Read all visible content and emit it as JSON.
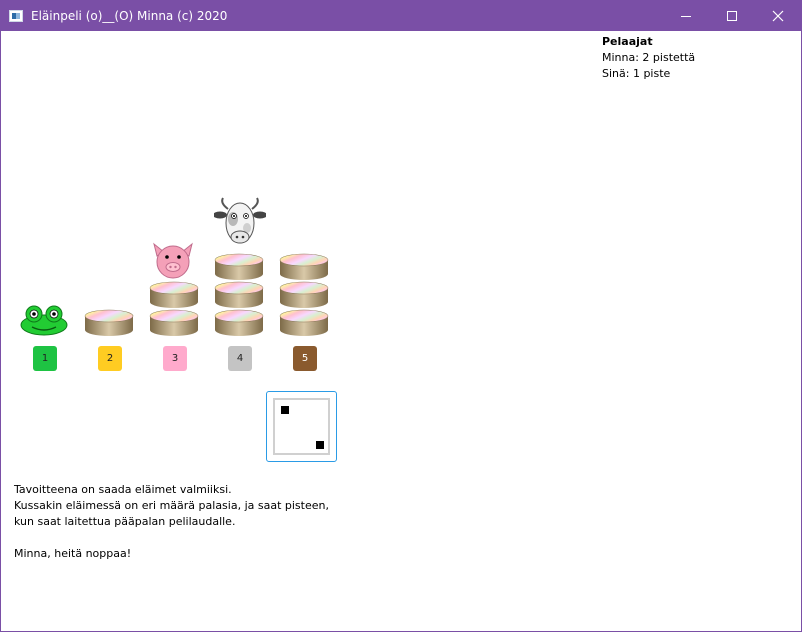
{
  "window": {
    "title": "Eläinpeli (o)__(O) Minna (c) 2020"
  },
  "players": {
    "header": "Pelaajat",
    "lines": [
      "Minna: 2 pistettä",
      "Sinä: 1 piste"
    ]
  },
  "board": {
    "pads": [
      {
        "label": "1",
        "color": "#1ec343"
      },
      {
        "label": "2",
        "color": "#ffcc22"
      },
      {
        "label": "3",
        "color": "#ffaacc"
      },
      {
        "label": "4",
        "color": "#c4c4c4"
      },
      {
        "label": "5",
        "color": "#8a5a2e"
      }
    ],
    "animals": [
      "frog-icon",
      "pig-icon",
      "cow-icon"
    ]
  },
  "instructions": {
    "lines": [
      "Tavoitteena on saada eläimet valmiiksi.",
      "Kussakin eläimessä on eri määrä palasia, ja saat pisteen,",
      "kun saat laitettua pääpalan pelilaudalle."
    ],
    "prompt": "Minna, heitä noppaa!"
  }
}
